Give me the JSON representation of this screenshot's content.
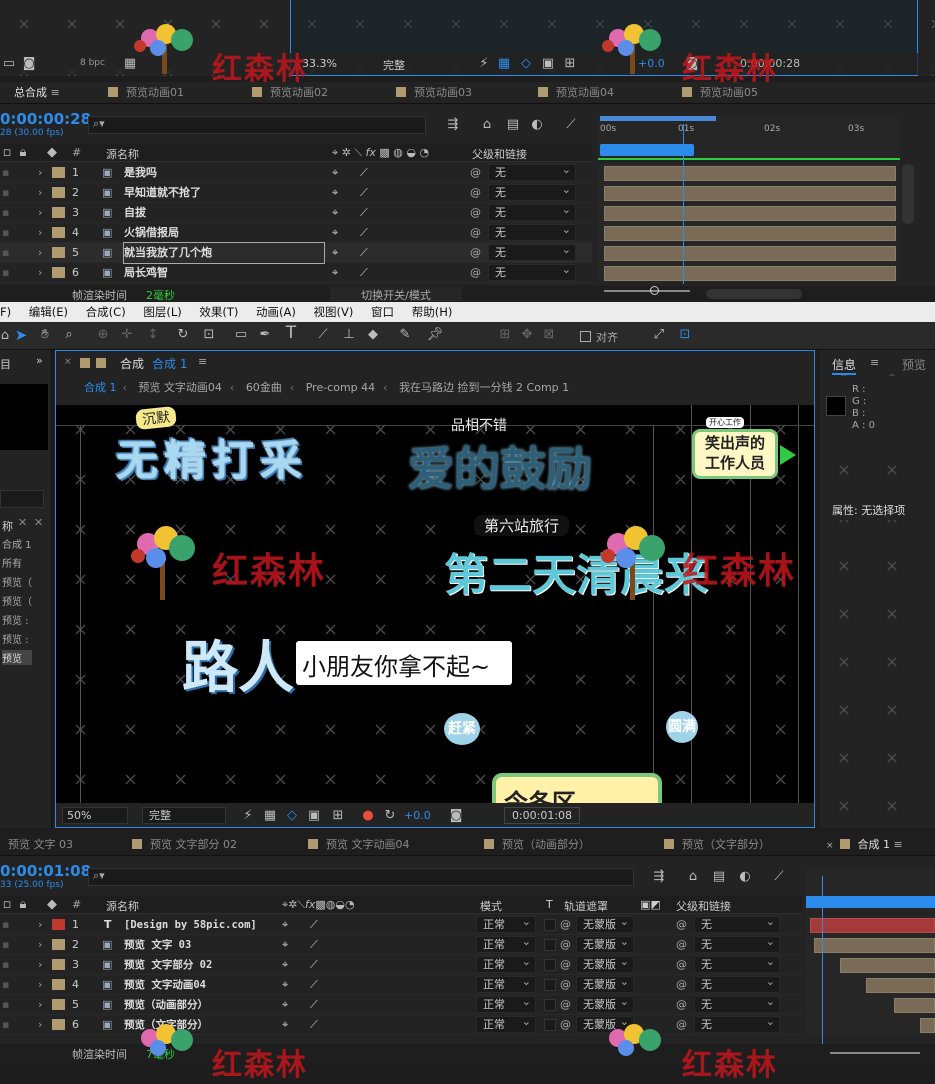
{
  "top_viewer": {
    "bit_depth": "8 bpc",
    "zoom": "33.3%",
    "quality": "完整",
    "exposure": "+0.0",
    "timecode": "0:00:00:28"
  },
  "top_tabs": [
    "总合成",
    "预览动画01",
    "预览动画02",
    "预览动画03",
    "预览动画04",
    "预览动画05"
  ],
  "top_timeline": {
    "timecode": "0:00:00:28",
    "fps": "28 (30.00 fps)",
    "columns": {
      "name": "源名称",
      "parent": "父级和链接"
    },
    "layers": [
      {
        "num": "1",
        "name": "是我吗",
        "parent": "无"
      },
      {
        "num": "2",
        "name": "早知道就不抢了",
        "parent": "无"
      },
      {
        "num": "3",
        "name": "自拔",
        "parent": "无"
      },
      {
        "num": "4",
        "name": "火锅借报局",
        "parent": "无"
      },
      {
        "num": "5",
        "name": "就当我放了几个炮",
        "parent": "无"
      },
      {
        "num": "6",
        "name": "局长鸡智",
        "parent": "无"
      }
    ],
    "render_label": "帧渲染时间",
    "render_value": "2毫秒",
    "toggle_label": "切换开关/模式",
    "ruler": [
      "00s",
      "01s",
      "02s",
      "03s"
    ]
  },
  "menu": [
    "F)",
    "编辑(E)",
    "合成(C)",
    "图层(L)",
    "效果(T)",
    "动画(A)",
    "视图(V)",
    "窗口",
    "帮助(H)"
  ],
  "toolbar": {
    "align_label": "对齐"
  },
  "comp_panel": {
    "title": "合成",
    "title_name": "合成 1",
    "breadcrumbs": [
      "合成 1",
      "预览 文字动画04",
      "60金曲",
      "Pre-comp 44",
      "我在马路边 捡到一分钱 2 Comp 1"
    ],
    "zoom": "50%",
    "quality": "完整",
    "exposure": "+0.0",
    "timecode": "0:00:01:08"
  },
  "canvas_text": {
    "silent": "沉默",
    "listless": "无精打采",
    "headline_small": "品相不错",
    "encourage": "爱的鼓励",
    "laugh_badge": "笑出声的",
    "laugh_badge2": "工作人员",
    "laugh_tag": "开心工作",
    "station": "第六站旅行",
    "second_day": "第二天清晨来",
    "passer": "路人",
    "kid": "小朋友你拿不起~",
    "hurry": "赶紧",
    "round": "圆满",
    "bottom_box": "今冬区"
  },
  "info_panel": {
    "title": "信息",
    "preview_tab": "预览",
    "r": "R :",
    "g": "G :",
    "b": "B :",
    "a": "A :  0",
    "props": "属性: 无选择项"
  },
  "left_panel": {
    "name_col": "称",
    "items": [
      "合成 1",
      "所有",
      "预览（",
      "预览（",
      "预览 :",
      "预览 :",
      "预览"
    ]
  },
  "bottom_tabs": [
    "预览 文字 03",
    "预览 文字部分 02",
    "预览 文字动画04",
    "预览（动画部分）",
    "预览（文字部分）",
    "合成 1"
  ],
  "bottom_timeline": {
    "timecode": "0:00:01:08",
    "fps": "33 (25.00 fps)",
    "columns": {
      "name": "源名称",
      "mode": "模式",
      "t": "T",
      "track": "轨道遮罩",
      "parent": "父级和链接"
    },
    "layers": [
      {
        "num": "1",
        "name": "[Design by 58pic.com]",
        "mode": "正常",
        "track": "无蒙版",
        "parent": "无",
        "color": "#c0392b",
        "type": "T"
      },
      {
        "num": "2",
        "name": "预览 文字 03",
        "mode": "正常",
        "track": "无蒙版",
        "parent": "无",
        "color": "#b09a70",
        "type": "comp"
      },
      {
        "num": "3",
        "name": "预览 文字部分 02",
        "mode": "正常",
        "track": "无蒙版",
        "parent": "无",
        "color": "#b09a70",
        "type": "comp"
      },
      {
        "num": "4",
        "name": "预览 文字动画04",
        "mode": "正常",
        "track": "无蒙版",
        "parent": "无",
        "color": "#b09a70",
        "type": "comp"
      },
      {
        "num": "5",
        "name": "预览（动画部分）",
        "mode": "正常",
        "track": "无蒙版",
        "parent": "无",
        "color": "#b09a70",
        "type": "comp"
      },
      {
        "num": "6",
        "name": "预览（文字部分）",
        "mode": "正常",
        "track": "无蒙版",
        "parent": "无",
        "color": "#b09a70",
        "type": "comp"
      }
    ],
    "render_label": "帧渲染时间",
    "render_value": "7毫秒"
  },
  "watermark": "红森林",
  "colors": {
    "accent": "#2d8ceb",
    "label_sand": "#b09a70",
    "label_red": "#c0392b",
    "green_bar": "#2ecc40"
  }
}
